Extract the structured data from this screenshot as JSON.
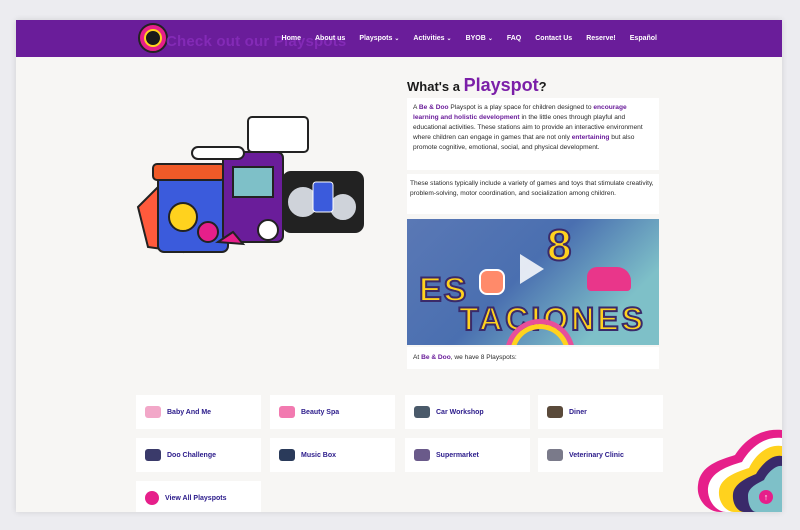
{
  "header": {
    "ghost_title": "Check out our Playspots",
    "menu": [
      {
        "label": "Home",
        "dropdown": false
      },
      {
        "label": "About us",
        "dropdown": false
      },
      {
        "label": "Playspots",
        "dropdown": true
      },
      {
        "label": "Activities",
        "dropdown": true
      },
      {
        "label": "BYOB",
        "dropdown": true
      },
      {
        "label": "FAQ",
        "dropdown": false
      },
      {
        "label": "Contact Us",
        "dropdown": false
      },
      {
        "label": "Reserve!",
        "dropdown": false
      },
      {
        "label": "Español",
        "dropdown": false
      }
    ]
  },
  "intro": {
    "heading_prefix": "What's a",
    "heading_brand": "Playspot",
    "heading_suffix": "?",
    "p1_a": "A ",
    "p1_brand": "Be & Doo",
    "p1_b": " Playspot is a play space for children designed to ",
    "p1_hl1": "encourage learning and holistic development",
    "p1_c": " in the little ones through playful and educational activities. These stations aim to provide an interactive environment where children can engage in games that are not only ",
    "p1_hl2": "entertaining",
    "p1_d": " but also promote cognitive, emotional, social, and physical development.",
    "p2": "These stations typically include a variety of games and toys that stimulate creativity, problem-solving, motor coordination, and socialization among children.",
    "p3_a": "At ",
    "p3_brand": "Be & Doo",
    "p3_b": ", we have 8 Playspots:"
  },
  "video": {
    "line1": "8",
    "line2": "ESTACIONES",
    "line2a": "ES",
    "line3": "TACIONES"
  },
  "playspots": [
    {
      "label": "Baby And Me",
      "icon": "baby-icon",
      "color": "#f2a7c8"
    },
    {
      "label": "Beauty Spa",
      "icon": "spa-icon",
      "color": "#f27ab0"
    },
    {
      "label": "Car Workshop",
      "icon": "car-icon",
      "color": "#4a5a6a"
    },
    {
      "label": "Diner",
      "icon": "diner-icon",
      "color": "#5a4a3a"
    },
    {
      "label": "Doo Challenge",
      "icon": "challenge-icon",
      "color": "#3a3a6a"
    },
    {
      "label": "Music Box",
      "icon": "music-icon",
      "color": "#2a3a5a"
    },
    {
      "label": "Supermarket",
      "icon": "market-icon",
      "color": "#6a5a8a"
    },
    {
      "label": "Veterinary Clinic",
      "icon": "vet-icon",
      "color": "#7a7a8a"
    },
    {
      "label": "View All Playspots",
      "icon": "logo-icon",
      "color": "#e61f8a"
    }
  ],
  "colors": {
    "brand": "#6a1d9a",
    "accent": "#e61f8a",
    "link": "#2a1a8a"
  }
}
